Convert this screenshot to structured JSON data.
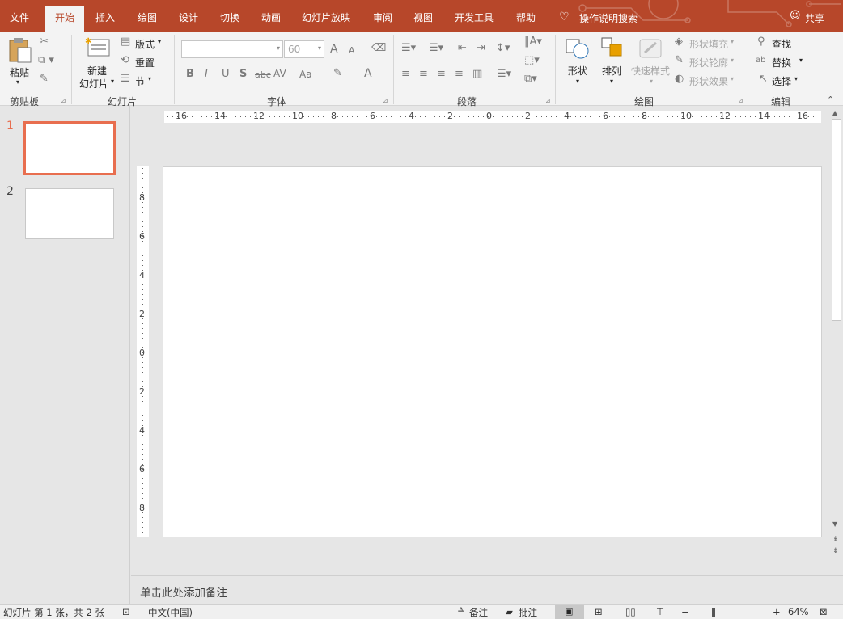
{
  "tabs": [
    "文件",
    "开始",
    "插入",
    "绘图",
    "设计",
    "切换",
    "动画",
    "幻灯片放映",
    "审阅",
    "视图",
    "开发工具",
    "帮助"
  ],
  "active_tab": "开始",
  "tell_me": "操作说明搜索",
  "share": "共享",
  "clipboard": {
    "paste": "粘贴",
    "group": "剪贴板"
  },
  "slides_group": {
    "new_slide_1": "新建",
    "new_slide_2": "幻灯片",
    "layout": "版式",
    "reset": "重置",
    "section": "节",
    "group": "幻灯片"
  },
  "font": {
    "family_value": "",
    "size_value": "60",
    "group": "字体",
    "bold": "B",
    "italic": "I",
    "underline": "U",
    "shadow": "S",
    "strike": "abc",
    "spacing": "AV",
    "case": "Aa",
    "grow": "A",
    "shrink": "A",
    "color": "A"
  },
  "paragraph": {
    "group": "段落"
  },
  "drawing": {
    "shapes": "形状",
    "arrange": "排列",
    "quick_styles": "快速样式",
    "fill": "形状填充",
    "outline": "形状轮廓",
    "effects": "形状效果",
    "group": "绘图"
  },
  "editing": {
    "find": "查找",
    "replace": "替换",
    "select": "选择",
    "group": "编辑"
  },
  "ruler_h": [
    "16",
    "14",
    "12",
    "10",
    "8",
    "6",
    "4",
    "2",
    "0",
    "2",
    "4",
    "6",
    "8",
    "10",
    "12",
    "14",
    "16"
  ],
  "ruler_v": [
    "8",
    "6",
    "4",
    "2",
    "0",
    "2",
    "4",
    "6",
    "8"
  ],
  "slides": [
    {
      "number": "1"
    },
    {
      "number": "2"
    }
  ],
  "notes_placeholder": "单击此处添加备注",
  "status": {
    "slide_info": "幻灯片 第 1 张，共 2 张",
    "language": "中文(中国)",
    "notes": "备注",
    "comments": "批注",
    "zoom": "64%"
  },
  "colors": {
    "accent": "#b7472a",
    "selection": "#e86e4f"
  }
}
